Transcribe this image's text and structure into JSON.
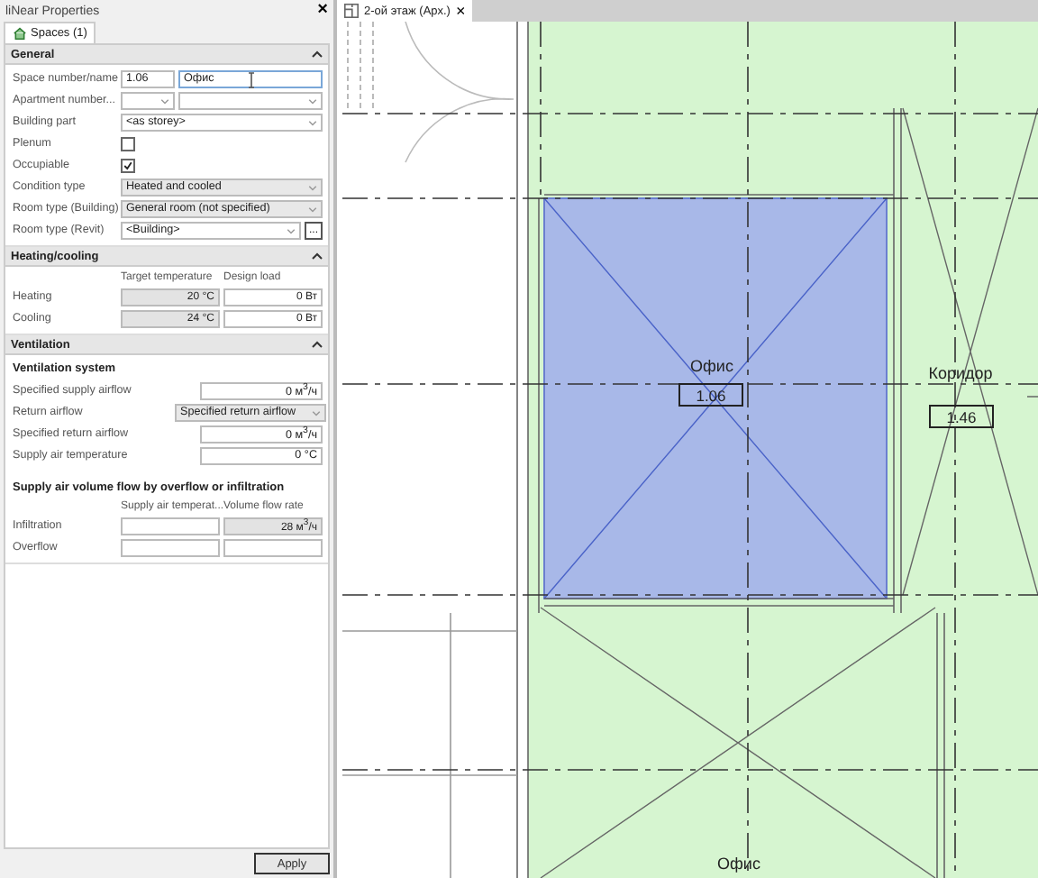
{
  "panel": {
    "title": "liNear Properties",
    "close": "×",
    "tab": {
      "label": "Spaces (1)"
    },
    "general": {
      "title": "General",
      "expanded": true,
      "rows": [
        {
          "kind": "pair",
          "label": "Space number/name",
          "value": "1.06",
          "value2": "Офис"
        },
        {
          "kind": "combo-pair",
          "label": "Apartment number..."
        },
        {
          "kind": "select",
          "label": "Building part",
          "value": "<as storey>"
        },
        {
          "kind": "checkbox",
          "label": "Plenum",
          "checked": false
        },
        {
          "kind": "checkbox",
          "label": "Occupiable",
          "checked": true
        },
        {
          "kind": "select",
          "label": "Condition type",
          "value": "Heated and cooled",
          "disabled": true
        },
        {
          "kind": "select",
          "label": "Room type (Building)",
          "value": "General room (not specified)",
          "disabled": true
        },
        {
          "kind": "select-button",
          "label": "Room type (Revit)",
          "value": "<Building>",
          "button": "..."
        }
      ]
    },
    "heating": {
      "title": "Heating/cooling",
      "expanded": true,
      "columns": [
        "Target temperature",
        "Design load"
      ],
      "rows": [
        {
          "label": "Heating",
          "target": "20 °C",
          "load": "0 Вт"
        },
        {
          "label": "Cooling",
          "target": "24 °C",
          "load": "0 Вт"
        }
      ]
    },
    "ventilation": {
      "title": "Ventilation",
      "expanded": true,
      "subtitle": "Ventilation system",
      "rows": [
        {
          "kind": "value",
          "label": "Specified supply airflow",
          "value": "0 м$^{3}$/ч"
        },
        {
          "kind": "select",
          "label": "Return airflow",
          "value": "Specified return airflow"
        },
        {
          "kind": "value",
          "label": "Specified return airflow",
          "value": "0 м$^{3}$/ч"
        },
        {
          "kind": "value",
          "label": "Supply air temperature",
          "value": "0 °C"
        }
      ],
      "subtitle2": "Supply air volume flow by overflow or infiltration",
      "columns": [
        "Supply air temperat...",
        "Volume flow rate"
      ],
      "flow_rows": [
        {
          "label": "Infiltration",
          "flow": "28 м$^{3}$/ч"
        },
        {
          "label": "Overflow"
        }
      ]
    },
    "apply": "Apply"
  },
  "document_tab": {
    "label": "2-ой этаж (Арх.)",
    "close": "×"
  },
  "plan": {
    "rooms": [
      {
        "name": "Офис",
        "number": "1.06",
        "selected": true
      },
      {
        "name": "Коридор",
        "number": "1.46",
        "selected": false
      },
      {
        "name": "Офис",
        "selected": false
      }
    ]
  }
}
